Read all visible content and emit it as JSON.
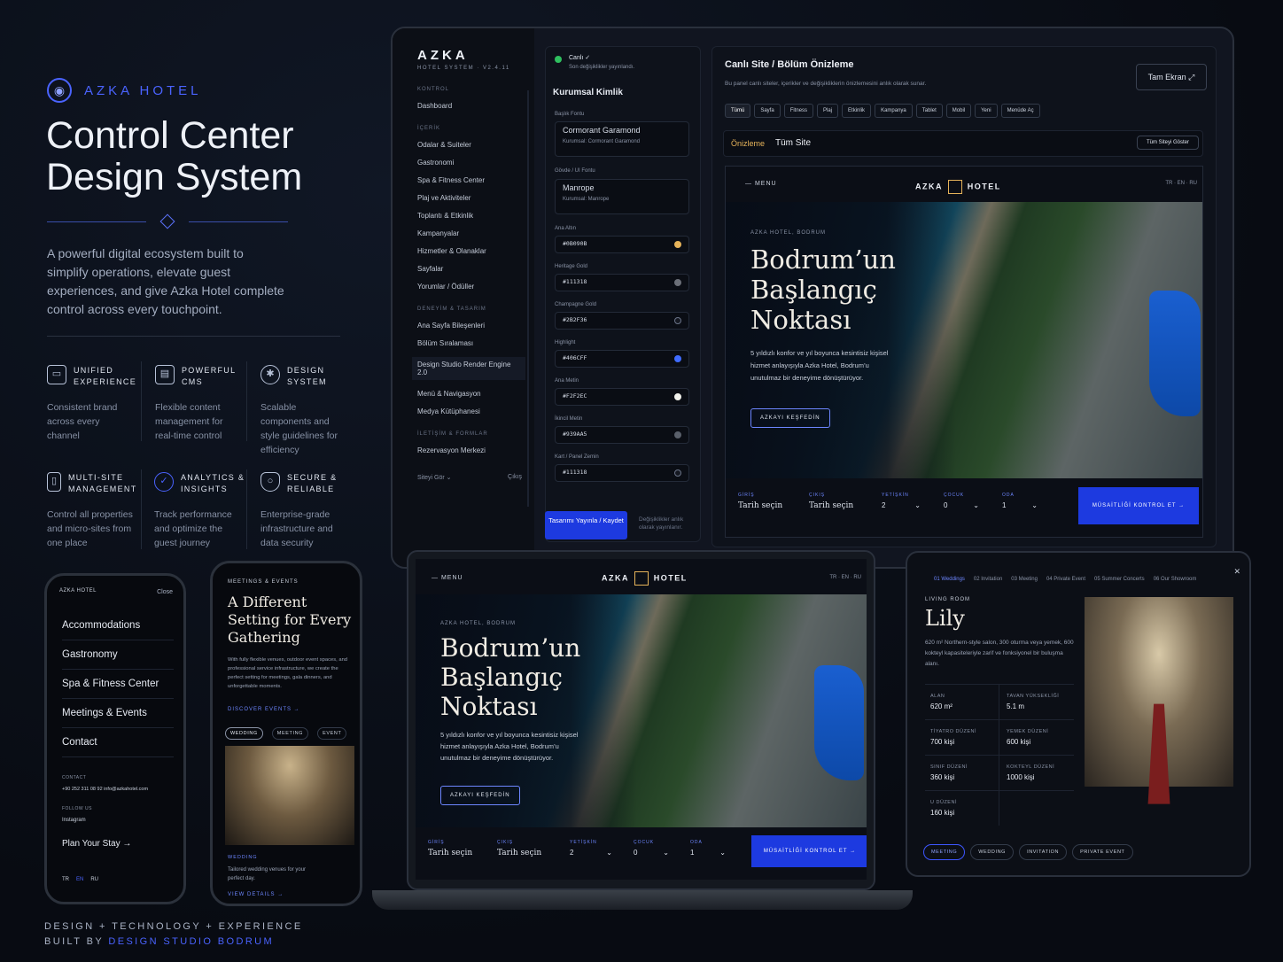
{
  "brand": {
    "name": "AZKA HOTEL",
    "title": "Control Center Design System",
    "description": "A powerful digital ecosystem built to simplify operations, elevate guest experiences, and give Azka Hotel complete control across every touchpoint."
  },
  "features": [
    {
      "icon": "document-icon",
      "title": "UNIFIED EXPERIENCE",
      "desc": "Consistent brand across every channel"
    },
    {
      "icon": "cms-icon",
      "title": "POWERFUL CMS",
      "desc": "Flexible content management for real-time control"
    },
    {
      "icon": "design-system-icon",
      "title": "DESIGN SYSTEM",
      "desc": "Scalable components and style guidelines for efficiency"
    },
    {
      "icon": "multi-site-icon",
      "title": "MULTI-SITE MANAGEMENT",
      "desc": "Control all properties and micro-sites from one place"
    },
    {
      "icon": "analytics-icon",
      "title": "ANALYTICS & INSIGHTS",
      "desc": "Track performance and optimize the guest journey"
    },
    {
      "icon": "shield-icon",
      "title": "SECURE & RELIABLE",
      "desc": "Enterprise-grade infrastructure and data security"
    }
  ],
  "footer": {
    "line1": "DESIGN + TECHNOLOGY + EXPERIENCE",
    "line2_prefix": "BUILT BY ",
    "line2_brand": "DESIGN STUDIO BODRUM"
  },
  "cms": {
    "logo": "AZKA",
    "version": "HOTEL SYSTEM · V2.4.11",
    "sections": [
      {
        "label": "KONTROL",
        "items": [
          "Dashboard"
        ]
      },
      {
        "label": "İÇERİK",
        "items": [
          "Odalar & Suiteler",
          "Gastronomi",
          "Spa & Fitness Center",
          "Plaj ve Aktiviteler",
          "Toplantı & Etkinlik",
          "Kampanyalar",
          "Hizmetler & Olanaklar",
          "Sayfalar",
          "Yorumlar / Ödüller"
        ]
      },
      {
        "label": "DENEYİM & TASARIM",
        "items": [
          "Ana Sayfa Bileşenleri",
          "Bölüm Sıralaması",
          "Design Studio Render Engine 2.0",
          "Menü & Navigasyon",
          "Medya Kütüphanesi"
        ]
      },
      {
        "label": "İLETİŞİM & FORMLAR",
        "items": [
          "Rezervasyon Merkezi"
        ]
      }
    ],
    "view_site": "Siteyi Gör ⌄",
    "logout": "Çıkış",
    "live_status": "Canlı ✓",
    "live_note": "Son değişiklikler yayınlandı.",
    "identity_title": "Kurumsal Kimlik",
    "heading_font_label": "Başlık Fontu",
    "heading_font": "Cormorant Garamond",
    "heading_font_sub": "Kurumsal: Cormorant Garamond",
    "body_font_label": "Gövde / UI Fontu",
    "body_font": "Manrope",
    "body_font_sub": "Kurumsal: Manrope",
    "colors": [
      {
        "label": "Ana Altın",
        "value": "#0B090B",
        "swatch": "#e6b35a"
      },
      {
        "label": "Heritage Gold",
        "value": "#111318",
        "swatch": "#6b6f78"
      },
      {
        "label": "Champagne Gold",
        "value": "#2B2F36",
        "swatch": "#151821"
      },
      {
        "label": "Highlight",
        "value": "#406CFF",
        "swatch": "#406cff"
      },
      {
        "label": "Ana Metin",
        "value": "#F2F2EC",
        "swatch": "#f2f2ec"
      },
      {
        "label": "İkincil Metin",
        "value": "#939AA5",
        "swatch": "#5a606b"
      },
      {
        "label": "Kart / Panel Zemin",
        "value": "#111318",
        "swatch": "#151821"
      }
    ],
    "radius_value": "16",
    "publish_button": "Tasarımı Yayınla / Kaydet",
    "publish_note": "Değişiklikler anlık olarak yayınlanır.",
    "preview_title": "Canlı Site / Bölüm Önizleme",
    "preview_desc": "Bu panel canlı siteler, içerikler ve değişikliklerin önizlemesini anlık olarak sunar.",
    "fullscreen": "Tam Ekran ⤢",
    "filters": [
      "Tümü",
      "Sayfa",
      "Fitness",
      "Plaj",
      "Etkinlik",
      "Kampanya",
      "Tablet",
      "Mobil",
      "Yeni",
      "Menüde Aç"
    ],
    "preview_tab_active": "Önizleme",
    "preview_tab": "Tüm Site",
    "show_all": "Tüm Siteyi Göster"
  },
  "site": {
    "menu": "MENU",
    "logo_left": "AZKA",
    "logo_right": "HOTEL",
    "langs": "TR · EN · RU",
    "eyebrow": "AZKA HOTEL, BODRUM",
    "headline": "Bodrum’un Başlangıç Noktası",
    "body": "5 yıldızlı konfor ve yıl boyunca kesintisiz kişisel hizmet anlayışıyla Azka Hotel, Bodrum’u unutulmaz bir deneyime dönüştürüyor.",
    "cta": "AZKAYI KEŞFEDİN",
    "booking": {
      "checkin_label": "GİRİŞ",
      "checkin": "Tarih seçin",
      "checkout_label": "ÇIKIŞ",
      "checkout": "Tarih seçin",
      "adult_label": "YETİŞKİN",
      "adult": "2",
      "child_label": "ÇOCUK",
      "child": "0",
      "room_label": "ODA",
      "room": "1",
      "submit": "MÜSAİTLİĞİ KONTROL ET →"
    }
  },
  "tablet": {
    "tabs": [
      "01 Weddings",
      "02 Invitation",
      "03 Meeting",
      "04 Private Event",
      "05 Summer Concerts",
      "06 Our Showroom"
    ],
    "close": "✕",
    "eyebrow": "LIVING ROOM",
    "title": "Lily",
    "desc": "620 m² Northern-style salon, 300 oturma veya yemek, 600 kokteyl kapasiteleriyle zarif ve fonksiyonel bir buluşma alanı.",
    "specs": [
      {
        "label": "ALAN",
        "value": "620 m²"
      },
      {
        "label": "TAVAN YÜKSEKLİĞİ",
        "value": "5.1 m"
      },
      {
        "label": "TİYATRO DÜZENİ",
        "value": "700 kişi"
      },
      {
        "label": "YEMEK DÜZENİ",
        "value": "600 kişi"
      },
      {
        "label": "SINIF DÜZENİ",
        "value": "360 kişi"
      },
      {
        "label": "KOKTEYL DÜZENİ",
        "value": "1000 kişi"
      },
      {
        "label": "U DÜZENİ",
        "value": "160 kişi"
      }
    ],
    "chips": [
      "MEETING",
      "WEDDING",
      "INVITATION",
      "PRIVATE EVENT"
    ]
  },
  "phone1": {
    "logo": "AZKA HOTEL",
    "close": "Close",
    "items": [
      "Accommodations",
      "Gastronomy",
      "Spa & Fitness Center",
      "Meetings & Events",
      "Contact"
    ],
    "contact_label": "CONTACT",
    "contact": "+90 252 311 08 92   info@azkahotel.com",
    "follow_label": "FOLLOW US",
    "follow": "Instagram",
    "plan": "Plan Your Stay →",
    "langs": [
      "TR",
      "EN",
      "RU"
    ]
  },
  "phone2": {
    "eyebrow": "MEETINGS & EVENTS",
    "title": "A Different Setting for Every Gathering",
    "desc": "With fully flexible venues, outdoor event spaces, and professional service infrastructure, we create the perfect setting for meetings, gala dinners, and unforgettable moments.",
    "link": "DISCOVER EVENTS →",
    "chips": [
      "WEDDING",
      "MEETING",
      "EVENT"
    ],
    "card_label": "WEDDING",
    "card_desc": "Tailored wedding venues for your perfect day.",
    "card_link": "VIEW DETAILS →"
  },
  "colors": {
    "accent": "#4a63ff",
    "cta": "#1d3ae0",
    "bg": "#0a0e17",
    "live": "#2fbf5f"
  }
}
